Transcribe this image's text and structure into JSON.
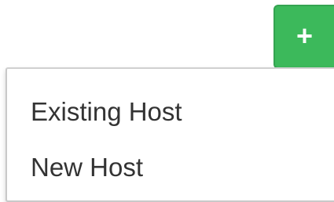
{
  "add_button": {
    "icon": "plus-icon",
    "glyph": "+",
    "color": "#3cb95b"
  },
  "menu": {
    "items": [
      {
        "label": "Existing Host"
      },
      {
        "label": "New Host"
      }
    ]
  }
}
